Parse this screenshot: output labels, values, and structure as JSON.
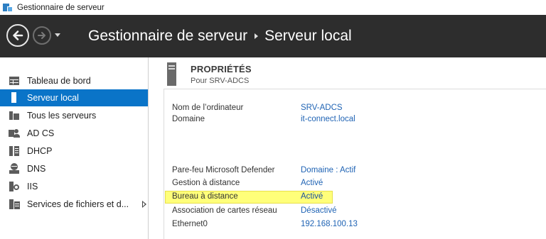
{
  "window": {
    "title": "Gestionnaire de serveur"
  },
  "header": {
    "breadcrumb": [
      "Gestionnaire de serveur",
      "Serveur local"
    ]
  },
  "sidebar": {
    "items": [
      {
        "label": "Tableau de bord",
        "icon": "dashboard-icon",
        "selected": false
      },
      {
        "label": "Serveur local",
        "icon": "local-server-icon",
        "selected": true
      },
      {
        "label": "Tous les serveurs",
        "icon": "all-servers-icon",
        "selected": false
      },
      {
        "label": "AD CS",
        "icon": "adcs-icon",
        "selected": false
      },
      {
        "label": "DHCP",
        "icon": "dhcp-icon",
        "selected": false
      },
      {
        "label": "DNS",
        "icon": "dns-icon",
        "selected": false
      },
      {
        "label": "IIS",
        "icon": "iis-icon",
        "selected": false
      },
      {
        "label": "Services de fichiers et d...",
        "icon": "file-services-icon",
        "selected": false,
        "has_submenu": true
      }
    ]
  },
  "properties": {
    "title": "PROPRIÉTÉS",
    "subtitle": "Pour SRV-ADCS",
    "rows": [
      {
        "key": "Nom de l’ordinateur",
        "value": "SRV-ADCS"
      },
      {
        "key": "Domaine",
        "value": "it-connect.local"
      },
      {
        "key": "Pare-feu Microsoft Defender",
        "value": "Domaine : Actif"
      },
      {
        "key": "Gestion à distance",
        "value": "Activé"
      },
      {
        "key": "Bureau à distance",
        "value": "Activé",
        "highlighted": true
      },
      {
        "key": "Association de cartes réseau",
        "value": "Désactivé"
      },
      {
        "key": "Ethernet0",
        "value": "192.168.100.13"
      }
    ]
  },
  "colors": {
    "header_bg": "#2d2d2d",
    "selected_bg": "#0a74c8",
    "link": "#1f63b4",
    "highlight": "#ffff7a"
  }
}
